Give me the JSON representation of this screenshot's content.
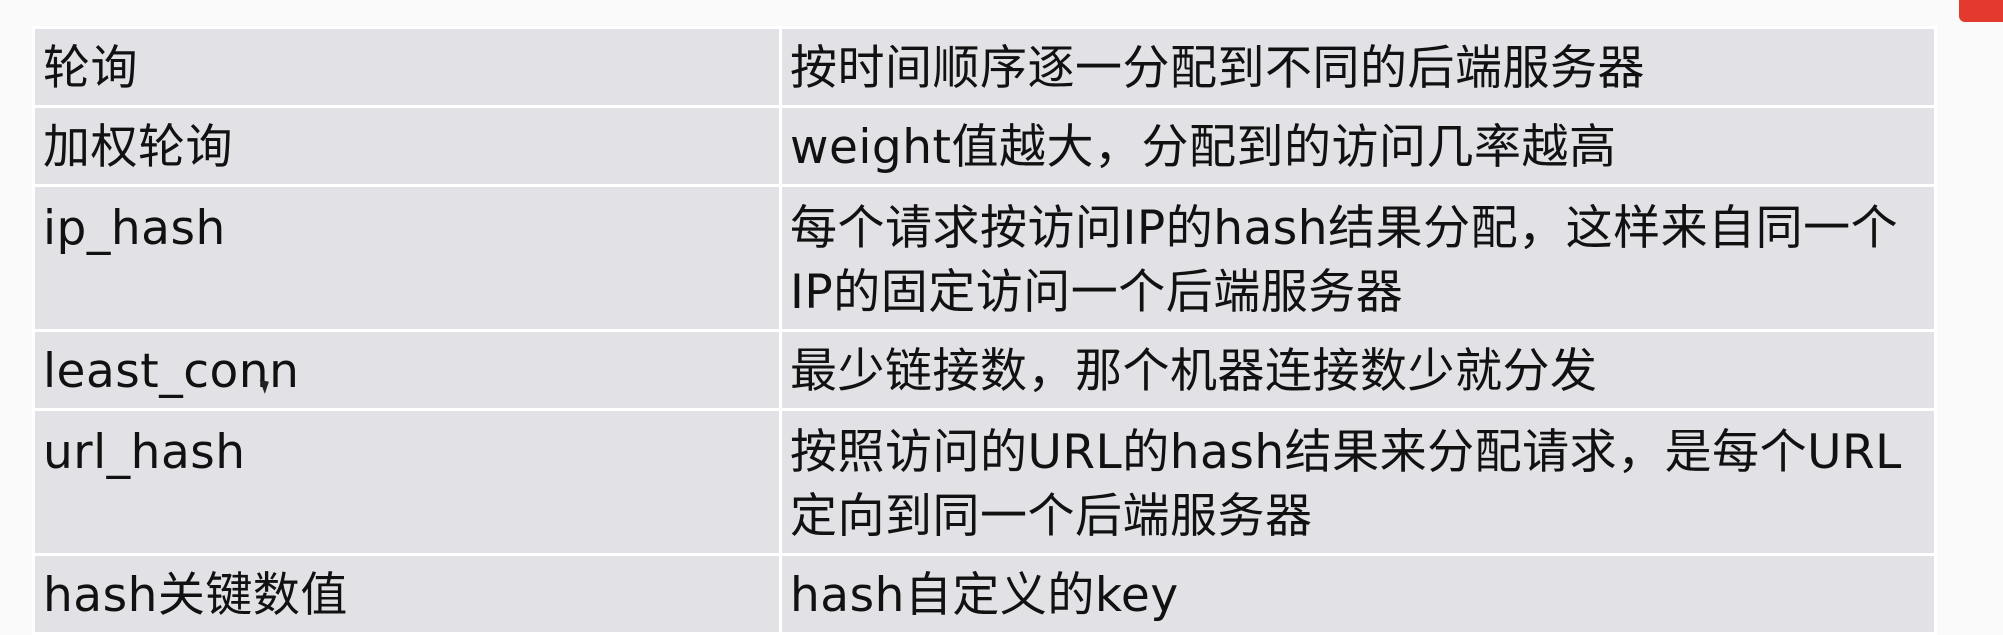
{
  "table": {
    "rows": [
      {
        "method": "轮询",
        "description": "按时间顺序逐一分配到不同的后端服务器"
      },
      {
        "method": "加权轮询",
        "description": "weight值越大，分配到的访问几率越高"
      },
      {
        "method": "ip_hash",
        "description": "每个请求按访问IP的hash结果分配，这样来自同一个IP的固定访问一个后端服务器"
      },
      {
        "method": "least_conn",
        "description": "最少链接数，那个机器连接数少就分发"
      },
      {
        "method": "url_hash",
        "description": "按照访问的URL的hash结果来分配请求，是每个URL定向到同一个后端服务器"
      },
      {
        "method": "hash关键数值",
        "description": "hash自定义的key"
      }
    ]
  },
  "colors": {
    "cell_bg": "#e2e2e6",
    "border": "#ffffff",
    "corner_badge": "#e23a2e"
  }
}
